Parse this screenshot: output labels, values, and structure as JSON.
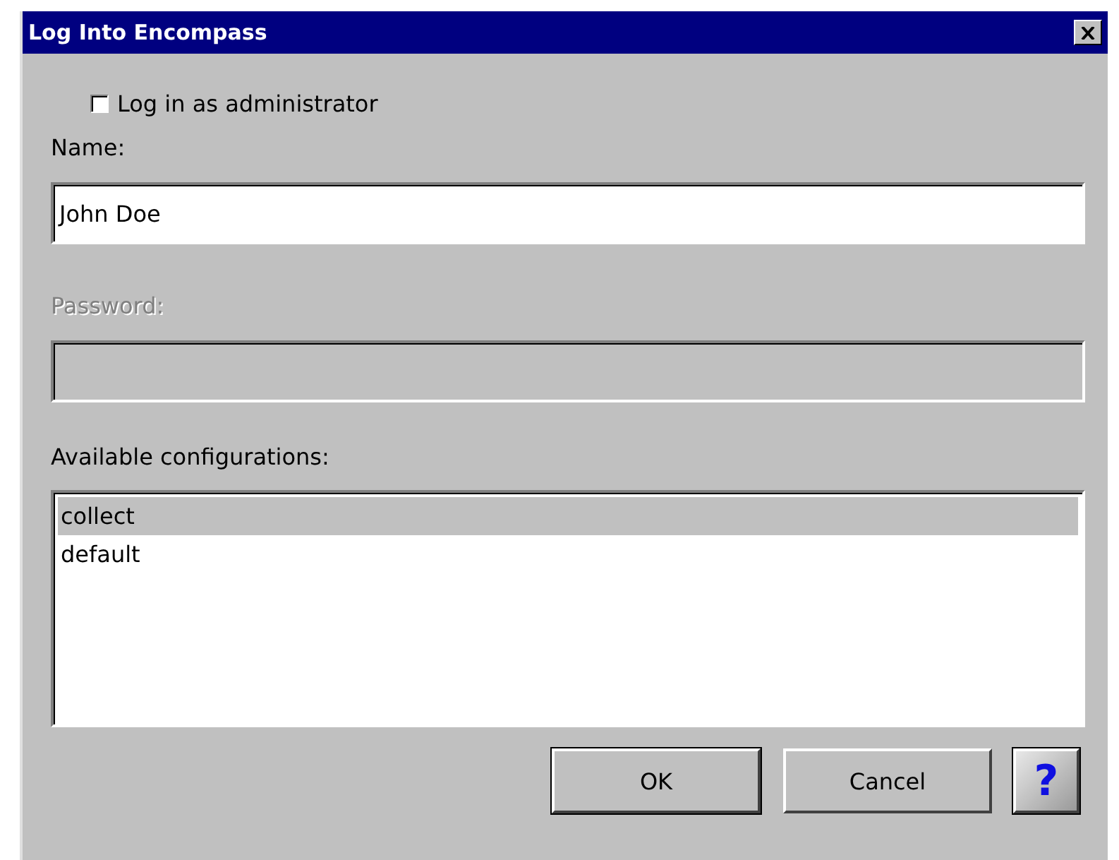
{
  "window": {
    "title": "Log Into Encompass"
  },
  "admin_checkbox": {
    "label": "Log in as administrator",
    "checked": false
  },
  "name": {
    "label": "Name:",
    "value": "John Doe",
    "disabled": false
  },
  "password": {
    "label": "Password:",
    "disabled": true
  },
  "configurations": {
    "label": "Available configurations:",
    "items": [
      {
        "label": "collect",
        "selected": true
      },
      {
        "label": "default",
        "selected": false
      }
    ]
  },
  "buttons": [
    {
      "label": "OK",
      "default": true
    },
    {
      "label": "Cancel",
      "default": false
    }
  ],
  "help": "?"
}
